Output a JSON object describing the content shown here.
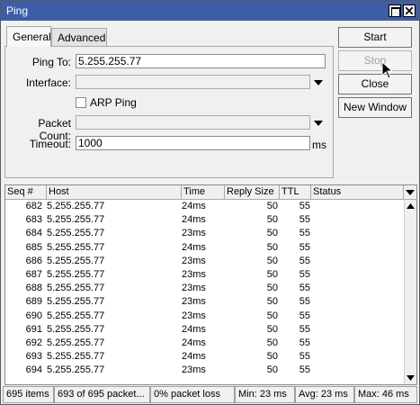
{
  "window": {
    "title": "Ping"
  },
  "tabs": [
    {
      "label": "General"
    },
    {
      "label": "Advanced"
    }
  ],
  "form": {
    "ping_to_label": "Ping To:",
    "ping_to_value": "5.255.255.77",
    "interface_label": "Interface:",
    "interface_value": "",
    "arp_ping_label": "ARP Ping",
    "arp_ping_checked": false,
    "packet_count_label": "Packet Count:",
    "packet_count_value": "",
    "timeout_label": "Timeout:",
    "timeout_value": "1000",
    "timeout_unit": "ms"
  },
  "buttons": {
    "start": "Start",
    "stop": "Stop",
    "close": "Close",
    "new_window": "New Window"
  },
  "table": {
    "columns": [
      "Seq #",
      "Host",
      "Time",
      "Reply Size",
      "TTL",
      "Status"
    ],
    "rows": [
      {
        "seq": "682",
        "host": "5.255.255.77",
        "time": "24ms",
        "reply_size": "50",
        "ttl": "55",
        "status": ""
      },
      {
        "seq": "683",
        "host": "5.255.255.77",
        "time": "24ms",
        "reply_size": "50",
        "ttl": "55",
        "status": ""
      },
      {
        "seq": "684",
        "host": "5.255.255.77",
        "time": "23ms",
        "reply_size": "50",
        "ttl": "55",
        "status": ""
      },
      {
        "seq": "685",
        "host": "5.255.255.77",
        "time": "24ms",
        "reply_size": "50",
        "ttl": "55",
        "status": ""
      },
      {
        "seq": "686",
        "host": "5.255.255.77",
        "time": "23ms",
        "reply_size": "50",
        "ttl": "55",
        "status": ""
      },
      {
        "seq": "687",
        "host": "5.255.255.77",
        "time": "23ms",
        "reply_size": "50",
        "ttl": "55",
        "status": ""
      },
      {
        "seq": "688",
        "host": "5.255.255.77",
        "time": "23ms",
        "reply_size": "50",
        "ttl": "55",
        "status": ""
      },
      {
        "seq": "689",
        "host": "5.255.255.77",
        "time": "23ms",
        "reply_size": "50",
        "ttl": "55",
        "status": ""
      },
      {
        "seq": "690",
        "host": "5.255.255.77",
        "time": "23ms",
        "reply_size": "50",
        "ttl": "55",
        "status": ""
      },
      {
        "seq": "691",
        "host": "5.255.255.77",
        "time": "24ms",
        "reply_size": "50",
        "ttl": "55",
        "status": ""
      },
      {
        "seq": "692",
        "host": "5.255.255.77",
        "time": "24ms",
        "reply_size": "50",
        "ttl": "55",
        "status": ""
      },
      {
        "seq": "693",
        "host": "5.255.255.77",
        "time": "24ms",
        "reply_size": "50",
        "ttl": "55",
        "status": ""
      },
      {
        "seq": "694",
        "host": "5.255.255.77",
        "time": "23ms",
        "reply_size": "50",
        "ttl": "55",
        "status": ""
      }
    ]
  },
  "status": {
    "items": "695 items",
    "packets": "693 of 695 packet...",
    "loss": "0% packet loss",
    "min": "Min: 23 ms",
    "avg": "Avg: 23 ms",
    "max": "Max: 46 ms"
  },
  "colors": {
    "titlebar": "#3d5ea6",
    "panel_bg": "#f0f0f0"
  }
}
